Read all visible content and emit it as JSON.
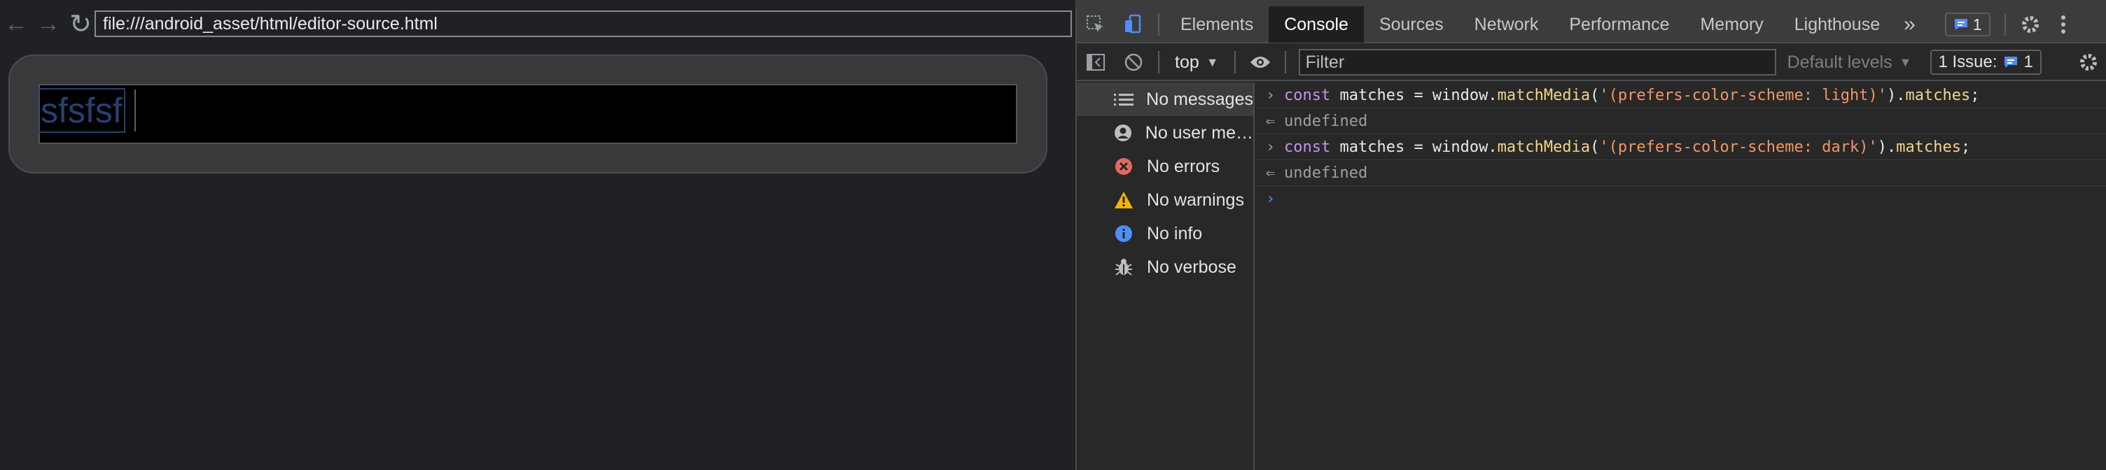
{
  "browser": {
    "url": "file:///android_asset/html/editor-source.html",
    "editor_text": "sfsfsf"
  },
  "devtools": {
    "tabs": [
      "Elements",
      "Console",
      "Sources",
      "Network",
      "Performance",
      "Memory",
      "Lighthouse"
    ],
    "active_tab": "Console",
    "more_tabs": "»",
    "messages_badge": "1",
    "context": "top",
    "filter_placeholder": "Filter",
    "levels_label": "Default levels",
    "issues_label": "1 Issue:",
    "issues_count": "1",
    "sidebar": [
      {
        "label": "No messages",
        "icon": "list-icon",
        "selected": true
      },
      {
        "label": "No user me…",
        "icon": "user-icon"
      },
      {
        "label": "No errors",
        "icon": "error-icon",
        "color": "#e46962"
      },
      {
        "label": "No warnings",
        "icon": "warning-icon",
        "color": "#f4b400"
      },
      {
        "label": "No info",
        "icon": "info-icon",
        "color": "#4f8ef7"
      },
      {
        "label": "No verbose",
        "icon": "bug-icon"
      }
    ],
    "console": [
      {
        "kind": "input",
        "code": "const matches = window.matchMedia('(prefers-color-scheme: light)').matches;"
      },
      {
        "kind": "result",
        "text": "undefined"
      },
      {
        "kind": "input",
        "code": "const matches = window.matchMedia('(prefers-color-scheme: dark)').matches;"
      },
      {
        "kind": "result",
        "text": "undefined"
      }
    ]
  }
}
